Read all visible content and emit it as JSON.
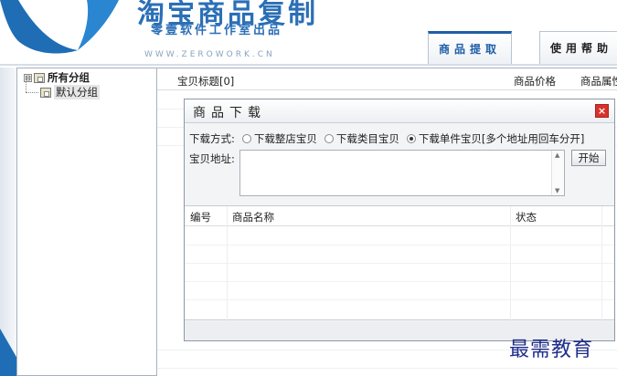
{
  "app": {
    "title": "淘宝商品复制",
    "subtitle": "零壹软件工作室出品",
    "url": "WWW.ZEROWORK.CN"
  },
  "tabs": [
    {
      "label": "商品提取",
      "active": true
    },
    {
      "label": "使用帮助",
      "active": false
    }
  ],
  "tree": {
    "root": {
      "label": "所有分组",
      "expander": "⊟"
    },
    "child": {
      "label": "默认分组"
    }
  },
  "list": {
    "columns": [
      "宝贝标题[0]",
      "商品价格",
      "商品属性"
    ]
  },
  "dialog": {
    "title": "商品下载",
    "close_glyph": "×",
    "mode_label": "下载方式:",
    "modes": [
      {
        "label": "下载整店宝贝",
        "selected": false
      },
      {
        "label": "下载类目宝贝",
        "selected": false
      },
      {
        "label": "下载单件宝贝[多个地址用回车分开]",
        "selected": true
      }
    ],
    "address_label": "宝贝地址:",
    "address_value": "",
    "start_button": "开始",
    "table_columns": [
      "编号",
      "商品名称",
      "状态"
    ]
  },
  "watermark": "最需教育",
  "colors": {
    "brand_blue": "#2b6fb6",
    "close_red": "#d9322b"
  }
}
